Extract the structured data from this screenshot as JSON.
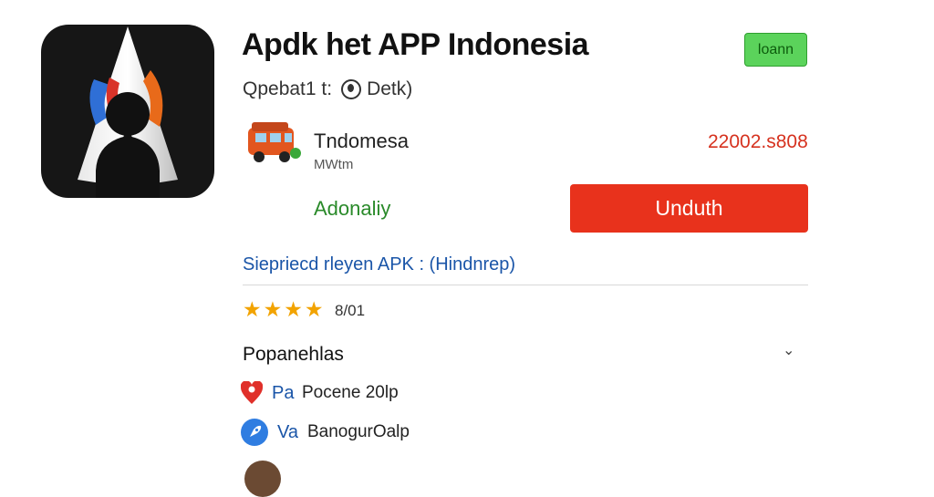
{
  "app": {
    "title": "Apdk het APP Indonesia",
    "developer_label": "Qpebat1 t:",
    "developer_name": "Detk)"
  },
  "header": {
    "login_label": "loann"
  },
  "category": {
    "name": "Tndomesa",
    "subtitle": "MWtm",
    "size": "22002.s808"
  },
  "availability": {
    "label": "Adonaliy"
  },
  "download": {
    "label": "Unduth"
  },
  "apk_link": {
    "label": "Siepriecd rleyen APK : (Hindnrep)"
  },
  "rating": {
    "stars": 4,
    "value": "8/01"
  },
  "section": {
    "title": "Popanehlas"
  },
  "info_rows": [
    {
      "icon": "map-pin-heart-icon",
      "key": "Pa",
      "value": "Pocene 20lp"
    },
    {
      "icon": "rocket-icon",
      "key": "Va",
      "value": "BanogurOalp"
    }
  ],
  "colors": {
    "accent_red": "#e8321c",
    "login_green": "#5bd35b",
    "link_blue": "#1a55a8",
    "star_orange": "#f2a300",
    "availability_green": "#2a8a2a"
  }
}
